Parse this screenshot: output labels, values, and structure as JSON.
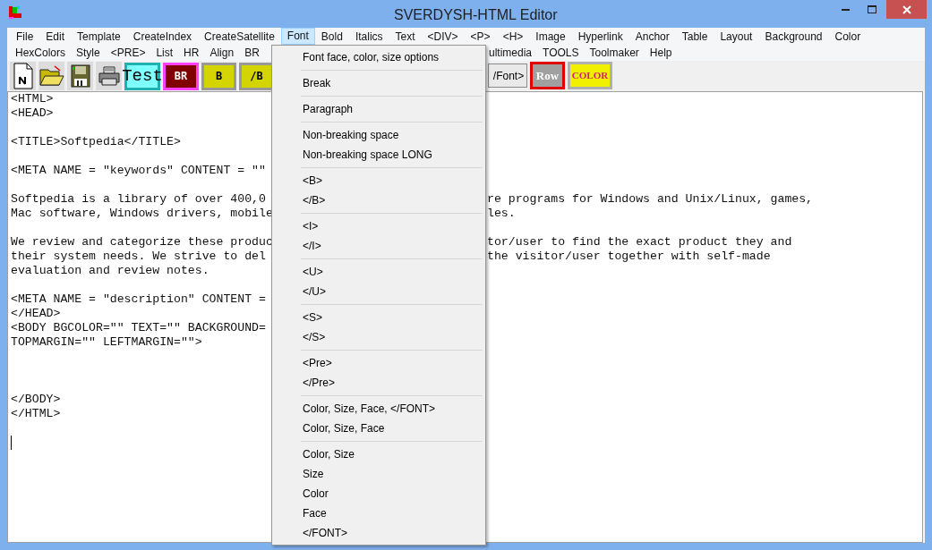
{
  "window": {
    "title": "SVERDYSH-HTML Editor"
  },
  "menu_bar": {
    "row_1": [
      {
        "label": "File",
        "selected": false
      },
      {
        "label": "Edit",
        "selected": false
      },
      {
        "label": "Template",
        "selected": false
      },
      {
        "label": "CreateIndex",
        "selected": false
      },
      {
        "label": "CreateSatellite",
        "selected": false
      },
      {
        "label": "Font",
        "selected": true
      },
      {
        "label": "Bold",
        "selected": false
      },
      {
        "label": "Italics",
        "selected": false
      },
      {
        "label": "Text",
        "selected": false
      },
      {
        "label": "<DIV>",
        "selected": false
      },
      {
        "label": "<P>",
        "selected": false
      },
      {
        "label": "<H>",
        "selected": false
      },
      {
        "label": "Image",
        "selected": false
      },
      {
        "label": "Hyperlink",
        "selected": false
      },
      {
        "label": "Anchor",
        "selected": false
      },
      {
        "label": "Table",
        "selected": false
      },
      {
        "label": "Layout",
        "selected": false
      },
      {
        "label": "Background",
        "selected": false
      },
      {
        "label": "Color",
        "selected": false
      }
    ],
    "row_2_left": [
      "HexColors",
      "Style",
      "<PRE>",
      "List",
      "HR",
      "Align",
      "BR"
    ],
    "row_2_right": [
      "ultimedia",
      "TOOLS",
      "Toolmaker",
      "Help"
    ]
  },
  "toolbar": {
    "left": [
      {
        "kind": "new"
      },
      {
        "kind": "open"
      },
      {
        "kind": "save"
      },
      {
        "kind": "print"
      },
      {
        "kind": "test",
        "label": "Test"
      },
      {
        "kind": "br",
        "label": "BR"
      },
      {
        "kind": "bold",
        "label": "B"
      },
      {
        "kind": "bold",
        "label": "/B"
      }
    ],
    "right": [
      {
        "kind": "plain",
        "label": "/Font>"
      },
      {
        "kind": "row",
        "label": "Row"
      },
      {
        "kind": "color",
        "label": "COLOR"
      }
    ]
  },
  "editor": {
    "lines": [
      {
        "kind": "text",
        "left": "<HTML>"
      },
      {
        "kind": "text",
        "left": "<HEAD>"
      },
      {
        "kind": "blank"
      },
      {
        "kind": "text",
        "left": "<TITLE>Softpedia</TITLE>"
      },
      {
        "kind": "blank"
      },
      {
        "kind": "text",
        "left": "<META NAME = \"keywords\" CONTENT = \"\""
      },
      {
        "kind": "blank"
      },
      {
        "kind": "text",
        "left": "Softpedia is a library of over 400,0",
        "right": "re programs for Windows and Unix/Linux, games,"
      },
      {
        "kind": "text",
        "left": "Mac software, Windows drivers, mobile",
        "right": "les."
      },
      {
        "kind": "blank"
      },
      {
        "kind": "text",
        "left": "We review and categorize these produc",
        "right": "tor/user to find the exact product they and"
      },
      {
        "kind": "text",
        "left": "their system needs. We strive to del",
        "right": "the visitor/user together with self-made"
      },
      {
        "kind": "text",
        "left": "evaluation and review notes."
      },
      {
        "kind": "blank"
      },
      {
        "kind": "text",
        "left": "<META NAME = \"description\" CONTENT ="
      },
      {
        "kind": "text",
        "left": "</HEAD>"
      },
      {
        "kind": "text",
        "left": "<BODY BGCOLOR=\"\" TEXT=\"\" BACKGROUND="
      },
      {
        "kind": "text",
        "left": "TOPMARGIN=\"\" LEFTMARGIN=\"\">"
      },
      {
        "kind": "blank"
      },
      {
        "kind": "blank"
      },
      {
        "kind": "blank"
      },
      {
        "kind": "text",
        "left": "</BODY>"
      },
      {
        "kind": "text",
        "left": "</HTML>"
      },
      {
        "kind": "blank"
      },
      {
        "kind": "cursor"
      }
    ]
  },
  "font_menu": {
    "groups": [
      [
        "Font face, color, size options"
      ],
      [
        "Break"
      ],
      [
        "Paragraph"
      ],
      [
        "Non-breaking space",
        "Non-breaking space LONG"
      ],
      [
        "<B>",
        "</B>"
      ],
      [
        "<I>",
        "</I>"
      ],
      [
        "<U>",
        "</U>"
      ],
      [
        "<S>",
        "</S>"
      ],
      [
        "<Pre>",
        "</Pre>"
      ],
      [
        "Color, Size, Face, </FONT>",
        "Color, Size, Face"
      ],
      [
        "Color, Size",
        "Size",
        "Color",
        "Face",
        "</FONT>"
      ]
    ]
  }
}
